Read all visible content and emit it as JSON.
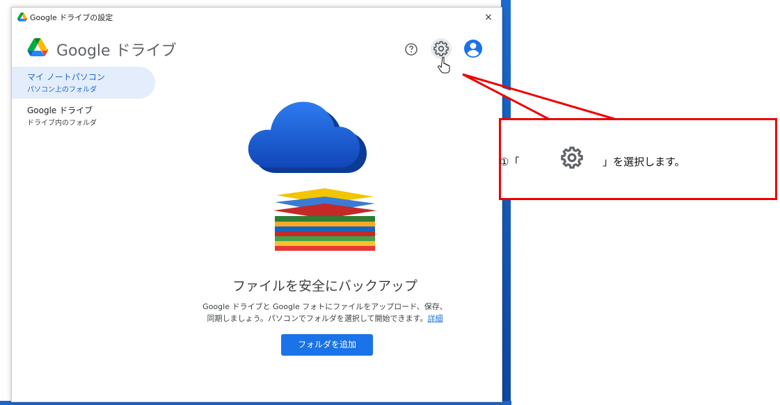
{
  "window": {
    "title": "Google ドライブの設定",
    "close_glyph": "×",
    "header_title": "Google ドライブ"
  },
  "toolbar": {
    "help_icon": "help-icon",
    "settings_icon": "gear-icon",
    "account_icon": "account-circle-icon"
  },
  "sidebar": {
    "items": [
      {
        "title": "マイ ノートパソコン",
        "subtitle": "パソコン上のフォルダ",
        "selected": true
      },
      {
        "title": "Google ドライブ",
        "subtitle": "ドライブ内のフォルダ",
        "selected": false
      }
    ]
  },
  "main": {
    "heading": "ファイルを安全にバックアップ",
    "description_line1": "Google ドライブと Google フォトにファイルをアップロード、保存、",
    "description_line2": "同期しましょう。パソコンでフォルダを選択して開始できます。",
    "learn_more": "詳細",
    "add_folder_label": "フォルダを追加"
  },
  "callout": {
    "text_before": "①「",
    "text_after": "」を選択します。",
    "icon": "gear-icon",
    "border_color": "#ee0000"
  },
  "colors": {
    "accent": "#1a73e8",
    "selected_bg": "#e3edfb"
  }
}
